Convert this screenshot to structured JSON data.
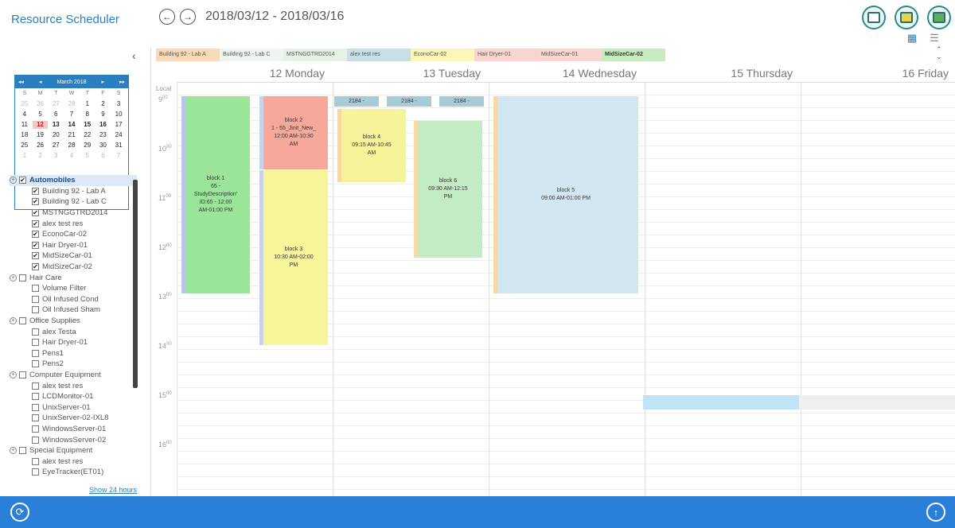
{
  "header": {
    "app_title": "Resource Scheduler",
    "date_range": "2018/03/12 - 2018/03/16",
    "prev_icon": "←",
    "next_icon": "→",
    "grid_icon": "▦",
    "list_icon": "☰"
  },
  "left_panel": {
    "collapse_icon": "‹",
    "mini_calendar": {
      "month_label": "March 2018",
      "prev_year_icon": "◂◂",
      "prev_month_icon": "◂",
      "next_month_icon": "▸",
      "next_year_icon": "▸▸",
      "weekdays": [
        "S",
        "M",
        "T",
        "W",
        "T",
        "F",
        "S"
      ],
      "days": [
        "25",
        "26",
        "27",
        "28",
        "1",
        "2",
        "3",
        "4",
        "5",
        "6",
        "7",
        "8",
        "9",
        "10",
        "11",
        "12",
        "13",
        "14",
        "15",
        "16",
        "17",
        "18",
        "19",
        "20",
        "21",
        "22",
        "23",
        "24",
        "25",
        "26",
        "27",
        "28",
        "29",
        "30",
        "31",
        "1",
        "2",
        "3",
        "4",
        "5",
        "6",
        "7"
      ]
    },
    "tree": [
      {
        "label": "Automobiles",
        "level": 0,
        "checked": true,
        "group": true
      },
      {
        "label": "Building 92 - Lab A",
        "level": 1,
        "checked": true
      },
      {
        "label": "Building 92 - Lab C",
        "level": 1,
        "checked": true
      },
      {
        "label": "MSTNGGTRD2014",
        "level": 1,
        "checked": true
      },
      {
        "label": "alex test res",
        "level": 1,
        "checked": true
      },
      {
        "label": "EconoCar-02",
        "level": 1,
        "checked": true
      },
      {
        "label": "Hair Dryer-01",
        "level": 1,
        "checked": true
      },
      {
        "label": "MidSizeCar-01",
        "level": 1,
        "checked": true
      },
      {
        "label": "MidSizeCar-02",
        "level": 1,
        "checked": true
      },
      {
        "label": "Hair Care",
        "level": 0,
        "checked": false,
        "group": true
      },
      {
        "label": "Volume Filter",
        "level": 1,
        "checked": false
      },
      {
        "label": "Oil Infused Cond",
        "level": 1,
        "checked": false
      },
      {
        "label": "Oil Infused Sham",
        "level": 1,
        "checked": false
      },
      {
        "label": "Office Supplies",
        "level": 0,
        "checked": false,
        "group": true
      },
      {
        "label": "alex Testa",
        "level": 1,
        "checked": false
      },
      {
        "label": "Hair Dryer-01",
        "level": 1,
        "checked": false
      },
      {
        "label": "Pens1",
        "level": 1,
        "checked": false
      },
      {
        "label": "Pens2",
        "level": 1,
        "checked": false
      },
      {
        "label": "Computer Equipment",
        "level": 0,
        "checked": false,
        "group": true
      },
      {
        "label": "alex test res",
        "level": 1,
        "checked": false
      },
      {
        "label": "LCDMonitor-01",
        "level": 1,
        "checked": false
      },
      {
        "label": "UnixServer-01",
        "level": 1,
        "checked": false
      },
      {
        "label": "UnixServer-02-IXL8",
        "level": 1,
        "checked": false
      },
      {
        "label": "WindowsServer-01",
        "level": 1,
        "checked": false
      },
      {
        "label": "WindowsServer-02",
        "level": 1,
        "checked": false
      },
      {
        "label": "Special Equipment",
        "level": 0,
        "checked": false,
        "group": true
      },
      {
        "label": "alex test res",
        "level": 1,
        "checked": false
      },
      {
        "label": "EyeTracker(ET01)",
        "level": 1,
        "checked": false
      }
    ],
    "show_24_hours": "Show 24 hours"
  },
  "resource_tabs": [
    {
      "label": "Building 92 - Lab A",
      "color": "#f9d9b8"
    },
    {
      "label": "Building 92 - Lab C",
      "color": "#eef5ee"
    },
    {
      "label": "MSTNGGTRD2014",
      "color": "#e6f2e6"
    },
    {
      "label": "alex test res",
      "color": "#c9dfe6"
    },
    {
      "label": "EconoCar-02",
      "color": "#fbf6b8"
    },
    {
      "label": "Hair Dryer-01",
      "color": "#f9d4cf"
    },
    {
      "label": "MidSizeCar-01",
      "color": "#fbd6d0"
    },
    {
      "label": "MidSizeCar-02",
      "color": "#c8ecc0"
    }
  ],
  "calendar": {
    "local_label": "Local",
    "days": [
      "12 Monday",
      "13 Tuesday",
      "14 Wednesday",
      "15 Thursday",
      "16 Friday"
    ],
    "hours": [
      "9",
      "10",
      "11",
      "12",
      "13",
      "14",
      "15",
      "16"
    ],
    "hour_suffix": "00",
    "blocks": [
      {
        "id": "block1",
        "text": "block 1\n65 -\nStudyDescription'\nID:65 - 12:00\nAM-01:00 PM",
        "color": "#9be59b",
        "edge": "#b7c6e8"
      },
      {
        "id": "block2",
        "text": "block 2\n1 - 55_Jinit_New_\n12:00 AM-10:30\nAM",
        "color": "#f7a89a",
        "edge": "#c9d2e8"
      },
      {
        "id": "block3",
        "text": "block 3\n10:30 AM-02:00\nPM",
        "color": "#f7f59a",
        "edge": "#c9d2e8"
      },
      {
        "id": "block4",
        "text": "block 4\n09:15 AM-10:45\nAM",
        "color": "#f7f39a",
        "edge": "#f7d9a8"
      },
      {
        "id": "block5",
        "text": "block 5\n09:00 AM-01:00 PM",
        "color": "#d3e7f3",
        "edge": "#f7d9a8"
      },
      {
        "id": "block6",
        "text": "block 6\n09:30 AM-12:15\nPM",
        "color": "#c4ecc4",
        "edge": "#f7d9a8"
      }
    ],
    "mini_blocks": [
      "2184 -",
      "2184 -",
      "2184 -"
    ],
    "mini_block_color": "#a9cbd5",
    "highlight_color": "#bfe3f7"
  },
  "footer": {
    "refresh_icon": "⟳",
    "upload_icon": "↑"
  }
}
